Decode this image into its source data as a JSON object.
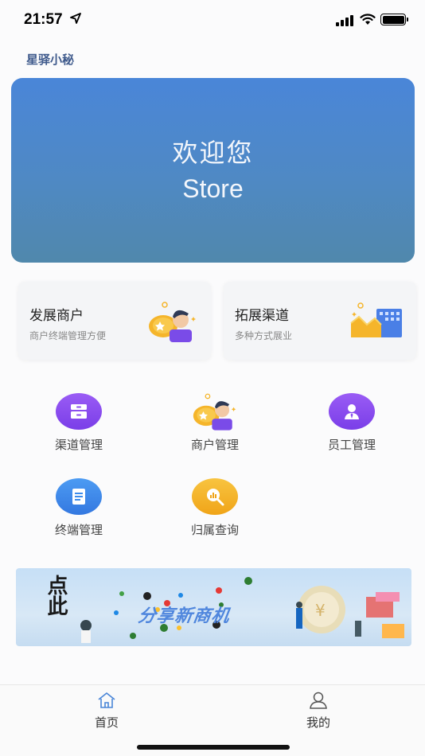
{
  "status_bar": {
    "time": "21:57"
  },
  "app": {
    "title": "星驿小秘"
  },
  "banner": {
    "welcome": "欢迎您",
    "store": "Store"
  },
  "cards": [
    {
      "title": "发展商户",
      "subtitle": "商户终端管理方便",
      "icon": "merchant-person-icon"
    },
    {
      "title": "拓展渠道",
      "subtitle": "多种方式展业",
      "icon": "building-growth-icon"
    }
  ],
  "grid": [
    {
      "label": "渠道管理",
      "icon": "drawer-icon",
      "color": "#8a4ef0"
    },
    {
      "label": "商户管理",
      "icon": "merchant-person-icon",
      "color": "#f5b52b"
    },
    {
      "label": "员工管理",
      "icon": "employee-icon",
      "color": "#8a4ef0"
    },
    {
      "label": "终端管理",
      "icon": "document-icon",
      "color": "#3d8cec"
    },
    {
      "label": "归属查询",
      "icon": "search-chart-icon",
      "color": "#f5b52b"
    }
  ],
  "promo": {
    "text": "分享新商机",
    "calligraphy": "点此"
  },
  "tabbar": {
    "items": [
      {
        "label": "首页",
        "active": true
      },
      {
        "label": "我的",
        "active": false
      }
    ]
  }
}
